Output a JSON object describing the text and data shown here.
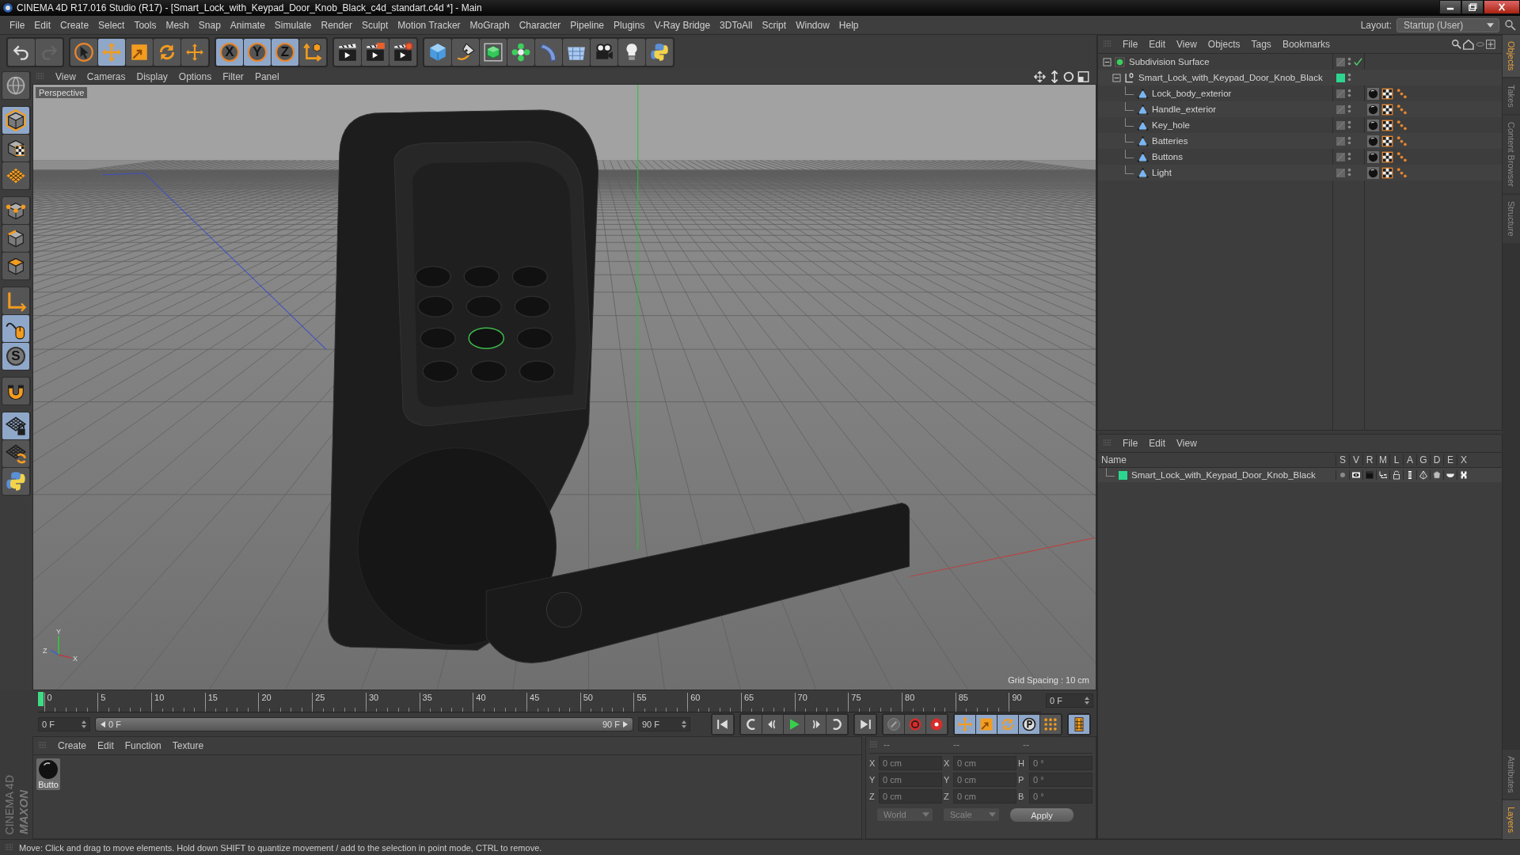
{
  "window": {
    "title": "CINEMA 4D R17.016 Studio (R17) - [Smart_Lock_with_Keypad_Door_Knob_Black_c4d_standart.c4d *] - Main"
  },
  "menu_bar": [
    "File",
    "Edit",
    "Create",
    "Select",
    "Tools",
    "Mesh",
    "Snap",
    "Animate",
    "Simulate",
    "Render",
    "Sculpt",
    "Motion Tracker",
    "MoGraph",
    "Character",
    "Pipeline",
    "Plugins",
    "V-Ray Bridge",
    "3DToAll",
    "Script",
    "Window",
    "Help"
  ],
  "layout": {
    "label": "Layout:",
    "value": "Startup (User)"
  },
  "toolbar": [
    [
      {
        "kind": "undo",
        "selected": false
      },
      {
        "kind": "redo",
        "selected": false
      }
    ],
    [
      {
        "kind": "select",
        "selected": false
      },
      {
        "kind": "move",
        "selected": true
      },
      {
        "kind": "scale",
        "selected": false
      },
      {
        "kind": "rotate",
        "selected": false
      },
      {
        "kind": "transform",
        "selected": false
      }
    ],
    [
      {
        "kind": "axis",
        "label": "X",
        "selected": true
      },
      {
        "kind": "axis",
        "label": "Y",
        "selected": true
      },
      {
        "kind": "axis",
        "label": "Z",
        "selected": true
      },
      {
        "kind": "coord",
        "selected": false
      }
    ],
    [
      {
        "kind": "renderview",
        "selected": false
      },
      {
        "kind": "renderpv",
        "selected": false
      },
      {
        "kind": "rendersettings",
        "selected": false
      }
    ],
    [
      {
        "kind": "cube",
        "selected": false
      },
      {
        "kind": "pen",
        "selected": false
      },
      {
        "kind": "subdiv",
        "selected": false
      },
      {
        "kind": "cloner",
        "selected": false
      },
      {
        "kind": "bend",
        "selected": false
      },
      {
        "kind": "floor",
        "selected": false
      },
      {
        "kind": "camera",
        "selected": false
      },
      {
        "kind": "light",
        "selected": false
      },
      {
        "kind": "python",
        "selected": false
      }
    ]
  ],
  "left_toolbar": [
    [
      {
        "kind": "editable",
        "selected": false
      }
    ],
    [
      {
        "kind": "model",
        "selected": true
      },
      {
        "kind": "texture",
        "selected": false
      },
      {
        "kind": "workplane",
        "selected": false
      }
    ],
    [
      {
        "kind": "points",
        "selected": false
      },
      {
        "kind": "edges",
        "selected": false
      },
      {
        "kind": "polygons",
        "selected": false
      }
    ],
    [
      {
        "kind": "axes",
        "selected": false
      },
      {
        "kind": "tweak",
        "selected": true
      },
      {
        "kind": "solo",
        "label": "S",
        "selected": true
      }
    ],
    [
      {
        "kind": "magnet",
        "selected": false
      }
    ],
    [
      {
        "kind": "wplock",
        "selected": true
      },
      {
        "kind": "wprotate",
        "selected": false
      },
      {
        "kind": "python",
        "selected": false
      }
    ]
  ],
  "viewport": {
    "menu": [
      "View",
      "Cameras",
      "Display",
      "Options",
      "Filter",
      "Panel"
    ],
    "camera": "Perspective",
    "grid_spacing": "Grid Spacing : 10 cm",
    "axis_labels": [
      "Y",
      "Z",
      "X"
    ]
  },
  "range_fill": {
    "level": 1
  },
  "timeline": {
    "ticks": [
      "0",
      "5",
      "10",
      "15",
      "20",
      "25",
      "30",
      "35",
      "40",
      "45",
      "50",
      "55",
      "60",
      "65",
      "70",
      "75",
      "80",
      "85",
      "90"
    ],
    "playhead": {
      "level": 0
    },
    "current_frame": "0 F",
    "start": "0 F",
    "range_start": "0 F",
    "range_end": "90 F",
    "end": "90 F"
  },
  "transport": [
    [
      {
        "kind": "first",
        "selected": false
      }
    ],
    [
      {
        "kind": "prevkey",
        "selected": false
      },
      {
        "kind": "prevframe",
        "selected": false
      },
      {
        "kind": "play",
        "selected": false
      },
      {
        "kind": "nextframe",
        "selected": false
      },
      {
        "kind": "nextkey",
        "selected": false
      }
    ],
    [
      {
        "kind": "last",
        "selected": false
      }
    ],
    [
      {
        "kind": "recordoff",
        "selected": false
      },
      {
        "kind": "record",
        "selected": false
      },
      {
        "kind": "autokey",
        "selected": false
      }
    ],
    [
      {
        "kind": "kmove",
        "selected": true
      },
      {
        "kind": "kscale",
        "selected": true
      },
      {
        "kind": "krotate",
        "selected": true
      },
      {
        "kind": "kparam",
        "selected": true
      },
      {
        "kind": "kpla",
        "selected": false
      }
    ],
    [
      {
        "kind": "timelinewin",
        "selected": true
      }
    ]
  ],
  "materials": {
    "menu": [
      "Create",
      "Edit",
      "Function",
      "Texture"
    ],
    "items": [
      {
        "name": "Butto",
        "selected": true
      }
    ]
  },
  "coordinates": {
    "headers": [
      "--",
      "--",
      "--"
    ],
    "rows": [
      {
        "pos_label": "X",
        "position": "0 cm",
        "size_label": "X",
        "size": "0 cm",
        "rot_label": "H",
        "rotation": "0 °"
      },
      {
        "pos_label": "Y",
        "position": "0 cm",
        "size_label": "Y",
        "size": "0 cm",
        "rot_label": "P",
        "rotation": "0 °"
      },
      {
        "pos_label": "Z",
        "position": "0 cm",
        "size_label": "Z",
        "size": "0 cm",
        "rot_label": "B",
        "rotation": "0 °"
      }
    ],
    "space": "World",
    "mode": "Scale",
    "apply": "Apply"
  },
  "logo": {
    "brand": "MAXON",
    "product": "CINEMA 4D"
  },
  "status_bar": "Move: Click and drag to move elements. Hold down SHIFT to quantize movement / add to the selection in point mode, CTRL to remove.",
  "objects": {
    "menu": [
      "File",
      "Edit",
      "View",
      "Objects",
      "Tags",
      "Bookmarks"
    ],
    "items": [
      {
        "name": "Subdivision Surface",
        "kind": "subdivision",
        "expanded": true,
        "enabled": true,
        "children": [
          {
            "name": "Smart_Lock_with_Keypad_Door_Knob_Black",
            "kind": "null",
            "expanded": true,
            "color": "#2dd68f",
            "children": [
              {
                "name": "Lock_body_exterior",
                "kind": "polygon",
                "tags": [
                  {
                    "kind": "material"
                  },
                  {
                    "kind": "uvw"
                  },
                  {
                    "kind": "phong"
                  }
                ]
              },
              {
                "name": "Handle_exterior",
                "kind": "polygon",
                "tags": [
                  {
                    "kind": "material"
                  },
                  {
                    "kind": "uvw"
                  },
                  {
                    "kind": "phong"
                  }
                ]
              },
              {
                "name": "Key_hole",
                "kind": "polygon",
                "tags": [
                  {
                    "kind": "material"
                  },
                  {
                    "kind": "uvw"
                  },
                  {
                    "kind": "phong"
                  }
                ]
              },
              {
                "name": "Batteries",
                "kind": "polygon",
                "tags": [
                  {
                    "kind": "material"
                  },
                  {
                    "kind": "uvw"
                  },
                  {
                    "kind": "phong"
                  }
                ]
              },
              {
                "name": "Buttons",
                "kind": "polygon",
                "tags": [
                  {
                    "kind": "material"
                  },
                  {
                    "kind": "uvw"
                  },
                  {
                    "kind": "phong"
                  }
                ]
              },
              {
                "name": "Light",
                "kind": "polygon",
                "tags": [
                  {
                    "kind": "material"
                  },
                  {
                    "kind": "uvw"
                  },
                  {
                    "kind": "phong"
                  }
                ]
              }
            ]
          }
        ]
      }
    ]
  },
  "layers": {
    "menu": [
      "File",
      "Edit",
      "View"
    ],
    "name_header": "Name",
    "flag_columns": [
      "S",
      "V",
      "R",
      "M",
      "L",
      "A",
      "G",
      "D",
      "E",
      "X"
    ],
    "rows": [
      {
        "name": "Smart_Lock_with_Keypad_Door_Knob_Black",
        "color": "#2dd68f"
      }
    ]
  },
  "side_tabs": {
    "top": [
      {
        "label": "Objects",
        "selected": true
      },
      {
        "label": "Takes",
        "selected": false
      },
      {
        "label": "Content Browser",
        "selected": false
      },
      {
        "label": "Structure",
        "selected": false
      }
    ],
    "bottom": [
      {
        "label": "Attributes",
        "selected": false
      },
      {
        "label": "Layers",
        "selected": true
      }
    ]
  }
}
